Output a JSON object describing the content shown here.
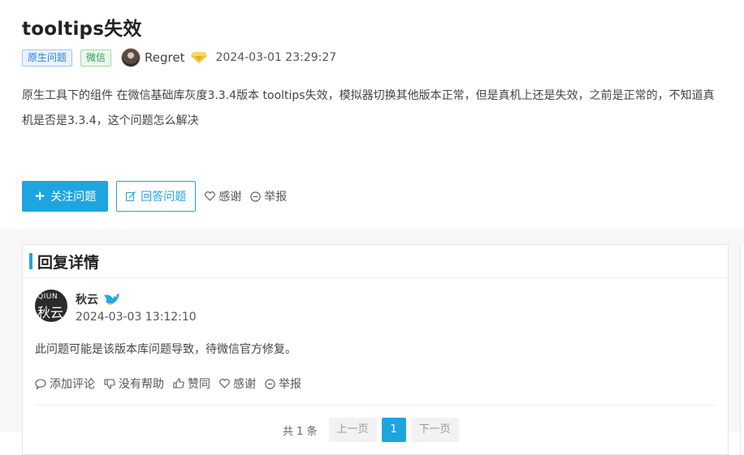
{
  "question": {
    "title": "tooltips失效",
    "tags": [
      "原生问题",
      "微信"
    ],
    "author": "Regret",
    "posted_at": "2024-03-01 23:29:27",
    "content": "原生工具下的组件 在微信基础库灰度3.3.4版本 tooltips失效，模拟器切换其他版本正常，但是真机上还是失效，之前是正常的，不知道真机是否是3.3.4，这个问题怎么解决",
    "actions": {
      "follow": "关注问题",
      "answer": "回答问题",
      "thanks": "感谢",
      "report": "举报"
    }
  },
  "replies_section": {
    "title": "回复详情",
    "replies": [
      {
        "name": "秋云",
        "avatar_text": {
          "ring": "QIUN",
          "cn": "秋云"
        },
        "time": "2024-03-03 13:12:10",
        "text": "此问题可能是该版本库问题导致，待微信官方修复。",
        "actions": {
          "comment": "添加评论",
          "unhelpful": "没有帮助",
          "like": "赞同",
          "thanks": "感谢",
          "report": "举报"
        }
      }
    ],
    "pagination": {
      "total": "共 1 条",
      "prev": "上一页",
      "current": "1",
      "next": "下一页"
    }
  },
  "colors": {
    "accent": "#1ea5e0",
    "tag_blue": "#2b7fd6",
    "tag_green": "#2aa34a"
  }
}
